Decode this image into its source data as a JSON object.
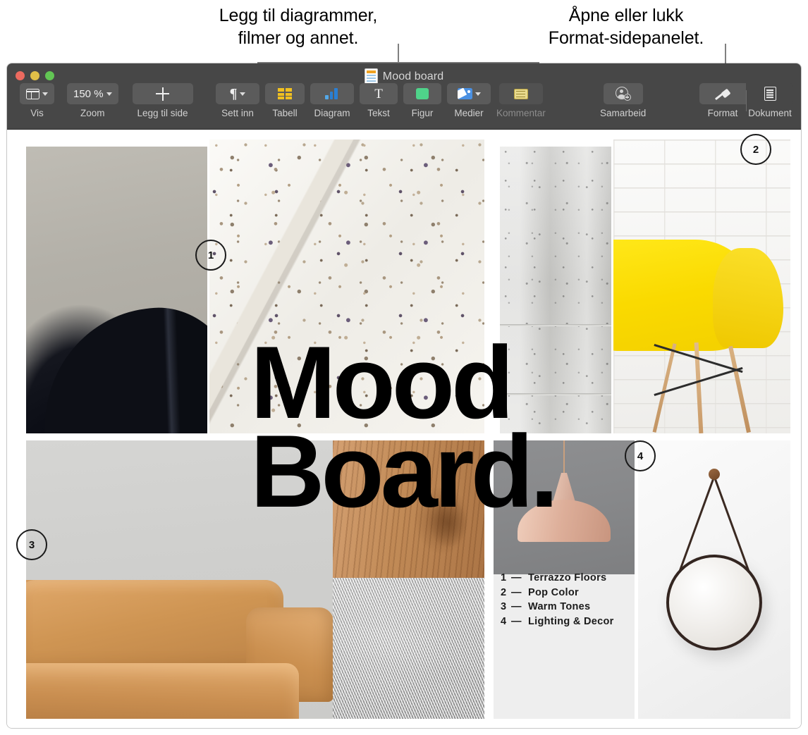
{
  "callouts": [
    {
      "id": "insert-callout",
      "text": "Legg til diagrammer,\nfilmer og annet."
    },
    {
      "id": "format-callout",
      "text": "Åpne eller lukk\nFormat-sidepanelet."
    }
  ],
  "window": {
    "title": "Mood board",
    "doc_icon": "pages-document-icon",
    "traffic_lights": [
      {
        "name": "close-button",
        "color": "#ec6a5f"
      },
      {
        "name": "minimize-button",
        "color": "#e0bf48"
      },
      {
        "name": "maximize-button",
        "color": "#62c554"
      }
    ]
  },
  "toolbar": {
    "left_group": [
      {
        "name": "view",
        "label": "Vis",
        "icon": "view-panel-icon",
        "has_chevron": true,
        "value": ""
      },
      {
        "name": "zoom",
        "label": "Zoom",
        "icon": "zoom-value",
        "has_chevron": true,
        "value": "150 %"
      },
      {
        "name": "add-page",
        "label": "Legg til side",
        "icon": "plus-icon",
        "has_chevron": false,
        "value": ""
      }
    ],
    "insert_group": [
      {
        "name": "insert",
        "label": "Sett inn",
        "icon": "pilcrow-icon",
        "has_chevron": true,
        "enabled": true
      },
      {
        "name": "table",
        "label": "Tabell",
        "icon": "table-icon",
        "has_chevron": false,
        "enabled": true
      },
      {
        "name": "chart",
        "label": "Diagram",
        "icon": "bar-chart-icon",
        "has_chevron": false,
        "enabled": true
      },
      {
        "name": "text",
        "label": "Tekst",
        "icon": "text-t-icon",
        "has_chevron": false,
        "enabled": true
      },
      {
        "name": "shape",
        "label": "Figur",
        "icon": "shape-square-icon",
        "has_chevron": false,
        "enabled": true
      },
      {
        "name": "media",
        "label": "Medier",
        "icon": "media-photo-icon",
        "has_chevron": true,
        "enabled": true
      },
      {
        "name": "comment",
        "label": "Kommentar",
        "icon": "comment-note-icon",
        "has_chevron": false,
        "enabled": false
      }
    ],
    "collaborate": {
      "name": "collaborate",
      "label": "Samarbeid",
      "icon": "add-person-icon"
    },
    "right_group": [
      {
        "name": "format",
        "label": "Format",
        "icon": "paintbrush-icon",
        "active": true
      },
      {
        "name": "document",
        "label": "Dokument",
        "icon": "document-lines-icon",
        "active": false
      }
    ]
  },
  "document": {
    "headline": "Mood\nBoard.",
    "legend": [
      {
        "num": "1",
        "dash": "—",
        "label": "Terrazzo Floors"
      },
      {
        "num": "2",
        "dash": "—",
        "label": "Pop Color"
      },
      {
        "num": "3",
        "dash": "—",
        "label": "Warm Tones"
      },
      {
        "num": "4",
        "dash": "—",
        "label": "Lighting & Decor"
      }
    ],
    "badges": [
      {
        "num": "1"
      },
      {
        "num": "2"
      },
      {
        "num": "3"
      },
      {
        "num": "4"
      }
    ],
    "images": [
      {
        "name": "dark-leather-chair-image",
        "alt": "Dark leather armchair on grey background"
      },
      {
        "name": "terrazzo-slab-image",
        "alt": "White terrazzo stone slab"
      },
      {
        "name": "concrete-wall-image",
        "alt": "Grey concrete wall texture"
      },
      {
        "name": "yellow-chair-image",
        "alt": "Yellow moulded chair against white brick wall"
      },
      {
        "name": "tan-sofa-image",
        "alt": "Tan leather sofa against plaster wall"
      },
      {
        "name": "wood-grain-image",
        "alt": "Warm wood grain texture"
      },
      {
        "name": "grey-fur-image",
        "alt": "Grey fur rug texture"
      },
      {
        "name": "pendant-lamp-image",
        "alt": "Pink pendant lamp on grey wall"
      },
      {
        "name": "round-mirror-image",
        "alt": "Round mirror with leather strap on white wall"
      }
    ]
  },
  "colors": {
    "toolbar_bg": "#474747",
    "toolbar_button": "#5b5b5b",
    "title_text": "#d6d6d6",
    "accent_yellow": "#f5e200",
    "accent_tan": "#c98e50",
    "callout_line": "#808080"
  }
}
